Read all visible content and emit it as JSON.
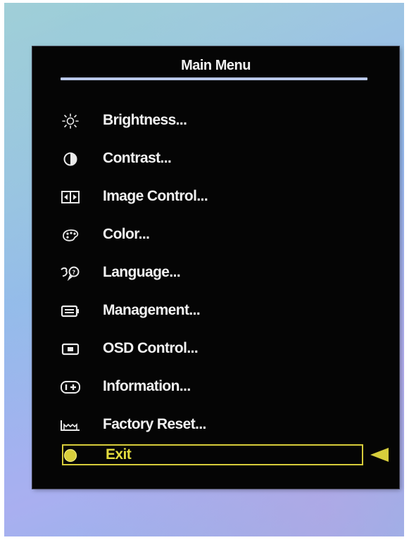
{
  "menu": {
    "title": "Main Menu",
    "items": [
      {
        "label": "Brightness...",
        "icon": "brightness-icon"
      },
      {
        "label": "Contrast...",
        "icon": "contrast-icon"
      },
      {
        "label": "Image Control...",
        "icon": "image-control-icon"
      },
      {
        "label": "Color...",
        "icon": "color-palette-icon"
      },
      {
        "label": "Language...",
        "icon": "language-icon"
      },
      {
        "label": "Management...",
        "icon": "management-icon"
      },
      {
        "label": "OSD Control...",
        "icon": "osd-control-icon"
      },
      {
        "label": "Information...",
        "icon": "information-icon"
      },
      {
        "label": "Factory Reset...",
        "icon": "factory-reset-icon"
      },
      {
        "label": "Exit",
        "icon": "exit-icon",
        "selected": true
      }
    ]
  },
  "colors": {
    "screen": "#050505",
    "text": "#f2f2f2",
    "highlight": "#d7cc3a",
    "title_rule": "#b9c8ea"
  }
}
